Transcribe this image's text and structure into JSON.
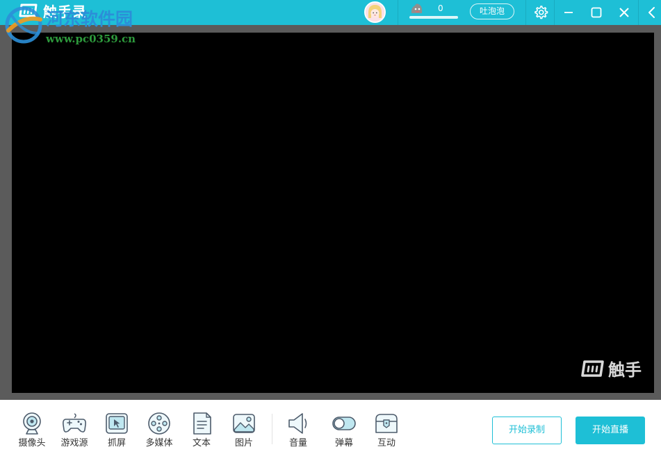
{
  "titlebar": {
    "app_name": "触手录",
    "bubble_count": "0",
    "bubble_button": "吐泡泡"
  },
  "watermark": {
    "site_name": "河东软件园",
    "url": "www.pc0359.cn"
  },
  "preview": {
    "logo_text": "触手"
  },
  "toolbar": {
    "tools": [
      {
        "label": "摄像头",
        "icon": "camera-icon"
      },
      {
        "label": "游戏源",
        "icon": "gamepad-icon"
      },
      {
        "label": "抓屏",
        "icon": "screen-capture-icon"
      },
      {
        "label": "多媒体",
        "icon": "film-reel-icon"
      },
      {
        "label": "文本",
        "icon": "document-icon"
      },
      {
        "label": "图片",
        "icon": "image-icon"
      },
      {
        "label": "音量",
        "icon": "speaker-icon"
      },
      {
        "label": "弹幕",
        "icon": "toggle-icon"
      },
      {
        "label": "互动",
        "icon": "chest-icon"
      }
    ],
    "record_button": "开始录制",
    "live_button": "开始直播"
  },
  "colors": {
    "accent": "#1ebfd6",
    "preview_frame": "#5b5b5b",
    "preview_canvas": "#000000",
    "icon_stroke": "#4d5b6b"
  }
}
